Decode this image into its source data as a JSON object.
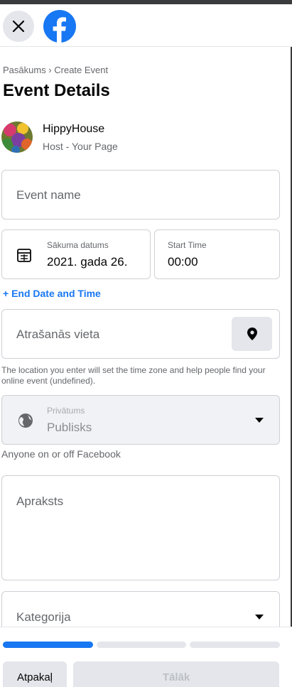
{
  "header": {
    "close_icon": "close-icon",
    "logo_icon": "facebook-logo-icon",
    "brand_color": "#1877f2"
  },
  "breadcrumb": "Pasākums › Create Event",
  "title": "Event Details",
  "host": {
    "name": "HippyHouse",
    "role": "Host - Your Page"
  },
  "form": {
    "event_name_placeholder": "Event name",
    "start_date_label": "Sākuma datums",
    "start_date_value": "2021. gada 26.",
    "start_time_label": "Start Time",
    "start_time_value": "00:00",
    "end_date_link": "+ End Date and Time",
    "location_placeholder": "Atrašanās vieta",
    "location_hint": "The location you enter will set the time zone and help people find your online event (undefined).",
    "privacy_label": "Privātums",
    "privacy_value": "Publisks",
    "privacy_note": "Anyone on or off Facebook",
    "description_placeholder": "Apraksts",
    "category_placeholder": "Kategorija"
  },
  "footer": {
    "progress_step": 1,
    "progress_total": 3,
    "back_label": "Atpakaļ",
    "next_label": "Tālāk"
  }
}
